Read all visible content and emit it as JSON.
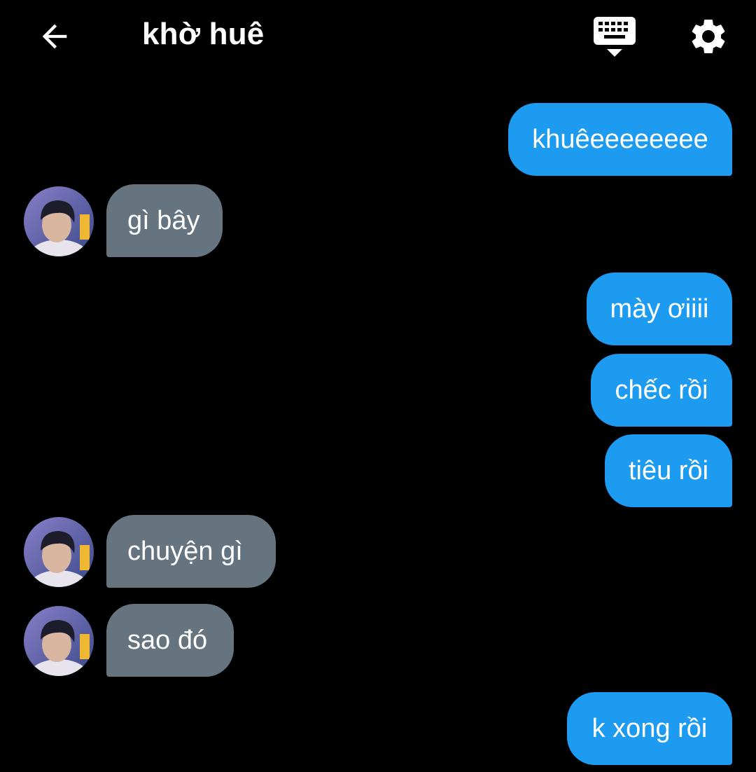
{
  "header": {
    "title": "khờ huê",
    "back_icon": "arrow-left-icon",
    "keyboard_icon": "keyboard-hide-icon",
    "settings_icon": "gear-icon"
  },
  "colors": {
    "background": "#000000",
    "outgoing_bubble": "#1d9bf0",
    "incoming_bubble": "#66747f",
    "text": "#ffffff"
  },
  "messages": [
    {
      "from": "me",
      "text": "khuêeeeeeeee"
    },
    {
      "from": "them",
      "text": "gì bây"
    },
    {
      "from": "me",
      "text": "mày ơiiii"
    },
    {
      "from": "me",
      "text": "chếc rồi"
    },
    {
      "from": "me",
      "text": "tiêu rồi"
    },
    {
      "from": "them",
      "text": "chuyện gì"
    },
    {
      "from": "them",
      "text": "sao đó"
    },
    {
      "from": "me",
      "text": "k xong rồi"
    }
  ]
}
